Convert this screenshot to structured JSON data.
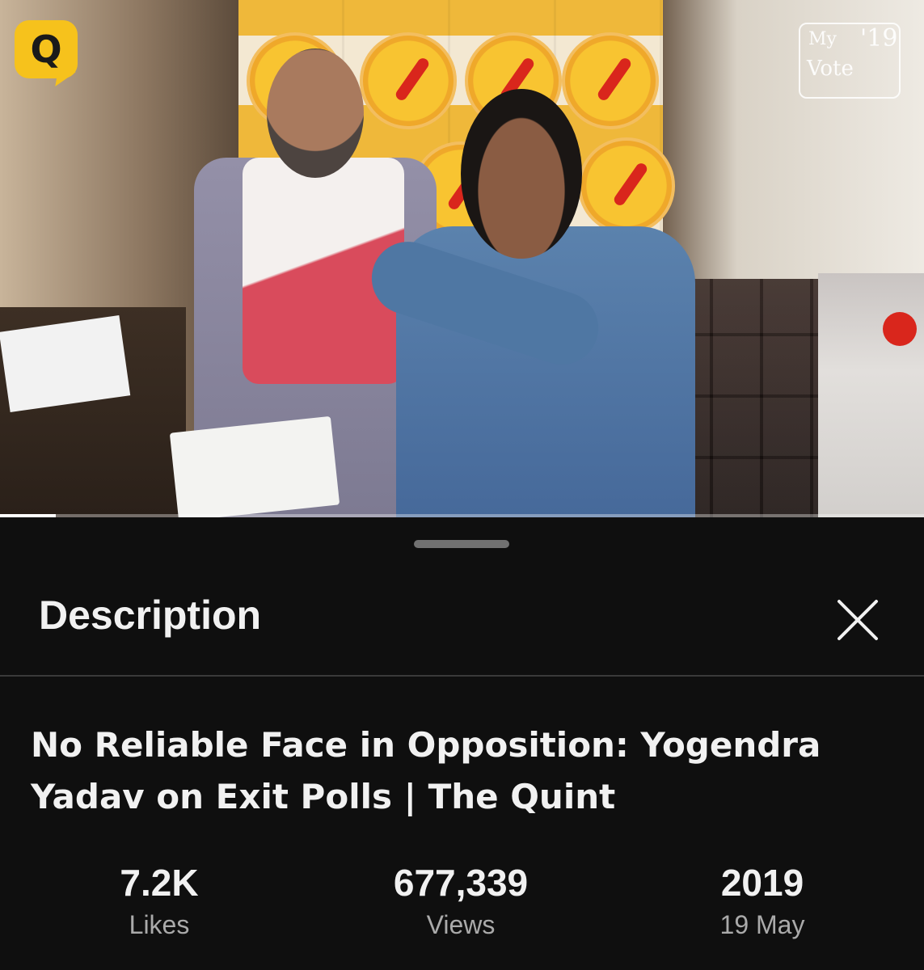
{
  "video": {
    "channel_logo_letter": "Q",
    "badge": {
      "my": "My",
      "vote": "Vote",
      "year": "'19"
    },
    "progress_fraction": 0.06
  },
  "sheet": {
    "title": "Description",
    "video_title": "No Reliable Face in Opposition: Yogendra Yadav on Exit Polls | The Quint",
    "stats": [
      {
        "value": "7.2K",
        "label": "Likes"
      },
      {
        "value": "677,339",
        "label": "Views"
      },
      {
        "value": "2019",
        "label": "19 May"
      }
    ]
  },
  "icons": {
    "close": "close-icon",
    "logo": "quint-logo-icon"
  },
  "colors": {
    "background": "#0f0f0f",
    "text_primary": "#f1f1f1",
    "text_secondary": "#aaaaaa",
    "logo_yellow": "#f6c21c"
  }
}
